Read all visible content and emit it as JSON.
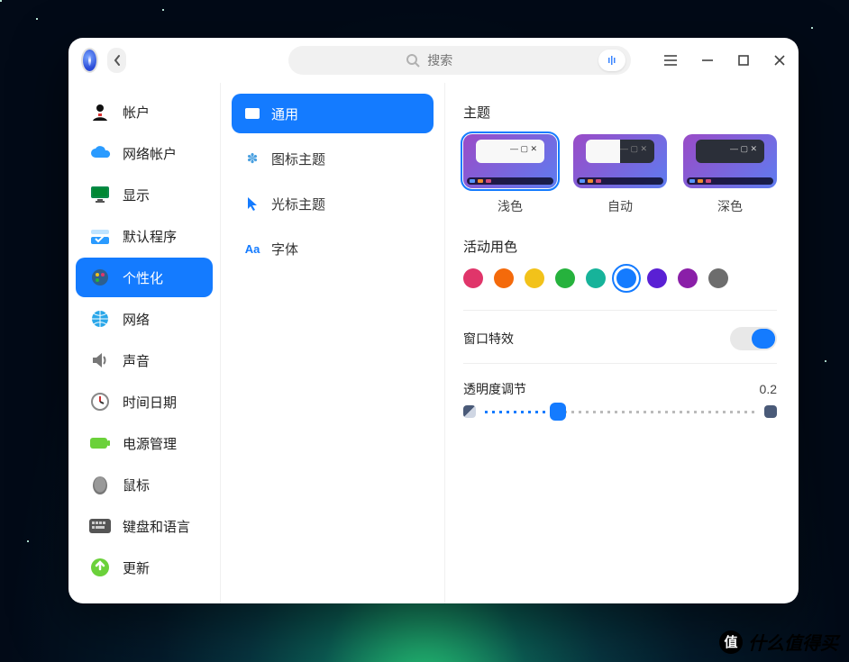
{
  "header": {
    "search_placeholder": "搜索"
  },
  "sidebar": {
    "items": [
      {
        "label": "帐户"
      },
      {
        "label": "网络帐户"
      },
      {
        "label": "显示"
      },
      {
        "label": "默认程序"
      },
      {
        "label": "个性化"
      },
      {
        "label": "网络"
      },
      {
        "label": "声音"
      },
      {
        "label": "时间日期"
      },
      {
        "label": "电源管理"
      },
      {
        "label": "鼠标"
      },
      {
        "label": "键盘和语言"
      },
      {
        "label": "更新"
      }
    ],
    "selected_index": 4
  },
  "tabs": {
    "items": [
      {
        "label": "通用"
      },
      {
        "label": "图标主题"
      },
      {
        "label": "光标主题"
      },
      {
        "label": "字体"
      }
    ],
    "selected_index": 0
  },
  "content": {
    "theme_section": "主题",
    "themes": [
      {
        "label": "浅色"
      },
      {
        "label": "自动"
      },
      {
        "label": "深色"
      }
    ],
    "selected_theme": 0,
    "accent_section": "活动用色",
    "accent_colors": [
      "#e0356a",
      "#f46a0b",
      "#f2c21a",
      "#26b23d",
      "#17b39a",
      "#147bff",
      "#5a20d4",
      "#8a1fa8",
      "#6d6d6d"
    ],
    "selected_accent": 5,
    "window_effects_label": "窗口特效",
    "window_effects_on": true,
    "opacity_label": "透明度调节",
    "opacity_value": "0.2",
    "opacity_fraction": 0.27
  },
  "watermark": "什么值得买"
}
